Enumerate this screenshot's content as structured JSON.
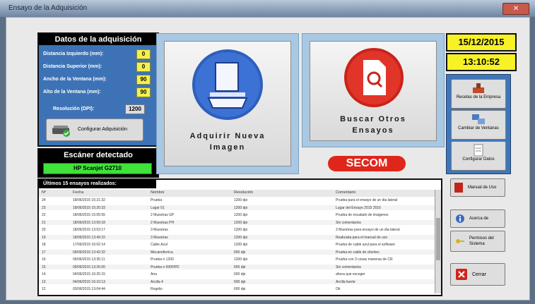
{
  "window": {
    "title": "Ensayo de la Adquisición"
  },
  "acquisition": {
    "title": "Datos de la adquisición",
    "fields": [
      {
        "label": "Distancia Izquierdo (mm):",
        "value": "0"
      },
      {
        "label": "Distancia Superior (mm):",
        "value": "0"
      },
      {
        "label": "Ancho de la Ventana (mm):",
        "value": "90"
      },
      {
        "label": "Alto de la Ventana (mm):",
        "value": "90"
      }
    ],
    "resolution_label": "Resolución (DPI):",
    "resolution_value": "1200",
    "configure_label": "Configurar Adquisición"
  },
  "scanner": {
    "title": "Escáner detectado",
    "value": "HP Scanjet G2710"
  },
  "acquire_button": {
    "line1": "Adquirir Nueva",
    "line2": "Imagen"
  },
  "search_button": {
    "line1": "Buscar Otros",
    "line2": "Ensayos"
  },
  "logo_text": "SECOM",
  "datetime": {
    "date": "15/12/2015",
    "time": "13:10:52"
  },
  "right_toolbar": [
    {
      "label": "Recetas de la Empresa"
    },
    {
      "label": "Cambiar de Ventanas"
    },
    {
      "label": "Configurar Datos"
    }
  ],
  "side_buttons": {
    "manual": "Manual de Uso",
    "about": "Acerca de",
    "permissions": "Permisos del Sistema",
    "close": "Cerrar"
  },
  "table": {
    "title": "Últimos 15 ensayos realizados:",
    "columns": [
      "Nº",
      "Fecha",
      "Nombre",
      "Resolución",
      "Comentario"
    ],
    "rows": [
      [
        "24",
        "18/06/2015 15:21:32",
        "Prueba",
        "1200 dpi",
        "Prueba para el ensayo de un dia lateral"
      ],
      [
        "23",
        "18/06/2015 15:20:33",
        "Lugar 01",
        "1200 dpi",
        "Lugar del Ensayo 2015 2016"
      ],
      [
        "22",
        "18/06/2015 15:05:55",
        "2 Muestras GP",
        "1200 dpi",
        "Prueba de escalado de imágenes"
      ],
      [
        "21",
        "18/06/2015 13:59:18",
        "2 Muestras PH",
        "1200 dpi",
        "Sin comentarios"
      ],
      [
        "20",
        "18/06/2015 13:53:17",
        "3 Muestras",
        "1200 dpi",
        "3 Muestras para ensayo de un dia lateral"
      ],
      [
        "19",
        "18/06/2015 13:49:15",
        "3 Muestras",
        "1200 dpi",
        "Realizada para el manual de uso"
      ],
      [
        "18",
        "17/06/2015 16:02:14",
        "Cable Azul",
        "1200 dpi",
        "Prueba de cable azul para el software"
      ],
      [
        "17",
        "09/06/2015 13:42:32",
        "Mecanoferrica",
        "600 dpi",
        "Prueba en cable de clientes"
      ],
      [
        "16",
        "09/06/2015 13:35:11",
        "Prueba n 1200",
        "1200 dpi",
        "Prueba con 3 cosas maneras de CR"
      ],
      [
        "15",
        "09/06/2015 13:26:00",
        "Prueba n 600HPD",
        "600 dpi",
        "Sin comentarios"
      ],
      [
        "14",
        "04/06/2015 16:25:15",
        "Ana",
        "600 dpi",
        "ahora que escoger"
      ],
      [
        "13",
        "04/06/2015 16:10:13",
        "Arcilla 4",
        "600 dpi",
        "Arcilla fuerte"
      ],
      [
        "12",
        "03/06/2015 13:04:44",
        "Rogelio",
        "600 dpi",
        "Ok"
      ]
    ]
  },
  "colors": {
    "panel_blue": "#3d73b6",
    "value_yellow": "#f6f04e",
    "scanner_green": "#3fe33a",
    "brand_red": "#e0261b"
  }
}
